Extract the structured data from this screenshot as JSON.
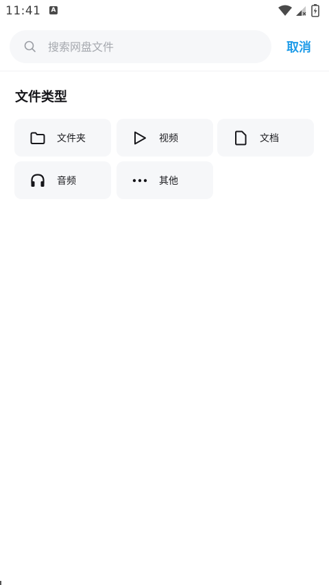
{
  "status_bar": {
    "time": "11:41",
    "app_icon_letter": "A"
  },
  "search": {
    "placeholder": "搜索网盘文件",
    "value": "",
    "cancel_label": "取消"
  },
  "section": {
    "title": "文件类型"
  },
  "file_types": [
    {
      "label": "文件夹",
      "icon": "folder-icon"
    },
    {
      "label": "视频",
      "icon": "play-icon"
    },
    {
      "label": "文档",
      "icon": "document-icon"
    },
    {
      "label": "音频",
      "icon": "headphones-icon"
    },
    {
      "label": "其他",
      "icon": "more-icon"
    }
  ],
  "colors": {
    "accent": "#1e9be8",
    "card_bg": "#f6f7f9",
    "search_bg": "#f6f7f9",
    "placeholder": "#a5a8ae"
  }
}
